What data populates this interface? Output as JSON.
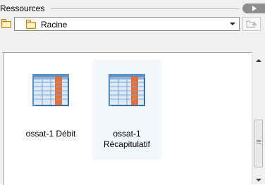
{
  "panel": {
    "title": "Ressources"
  },
  "tree": {
    "root_label": "Racine"
  },
  "items": [
    {
      "label": "ossat-1 Débit",
      "icon": "spreadsheet-icon"
    },
    {
      "label": "ossat-1 Récapitulatif",
      "icon": "spreadsheet-icon"
    }
  ],
  "colors": {
    "accent": "#e36f3b",
    "grid": "#5b8fc0",
    "folder": "#f6d889"
  }
}
